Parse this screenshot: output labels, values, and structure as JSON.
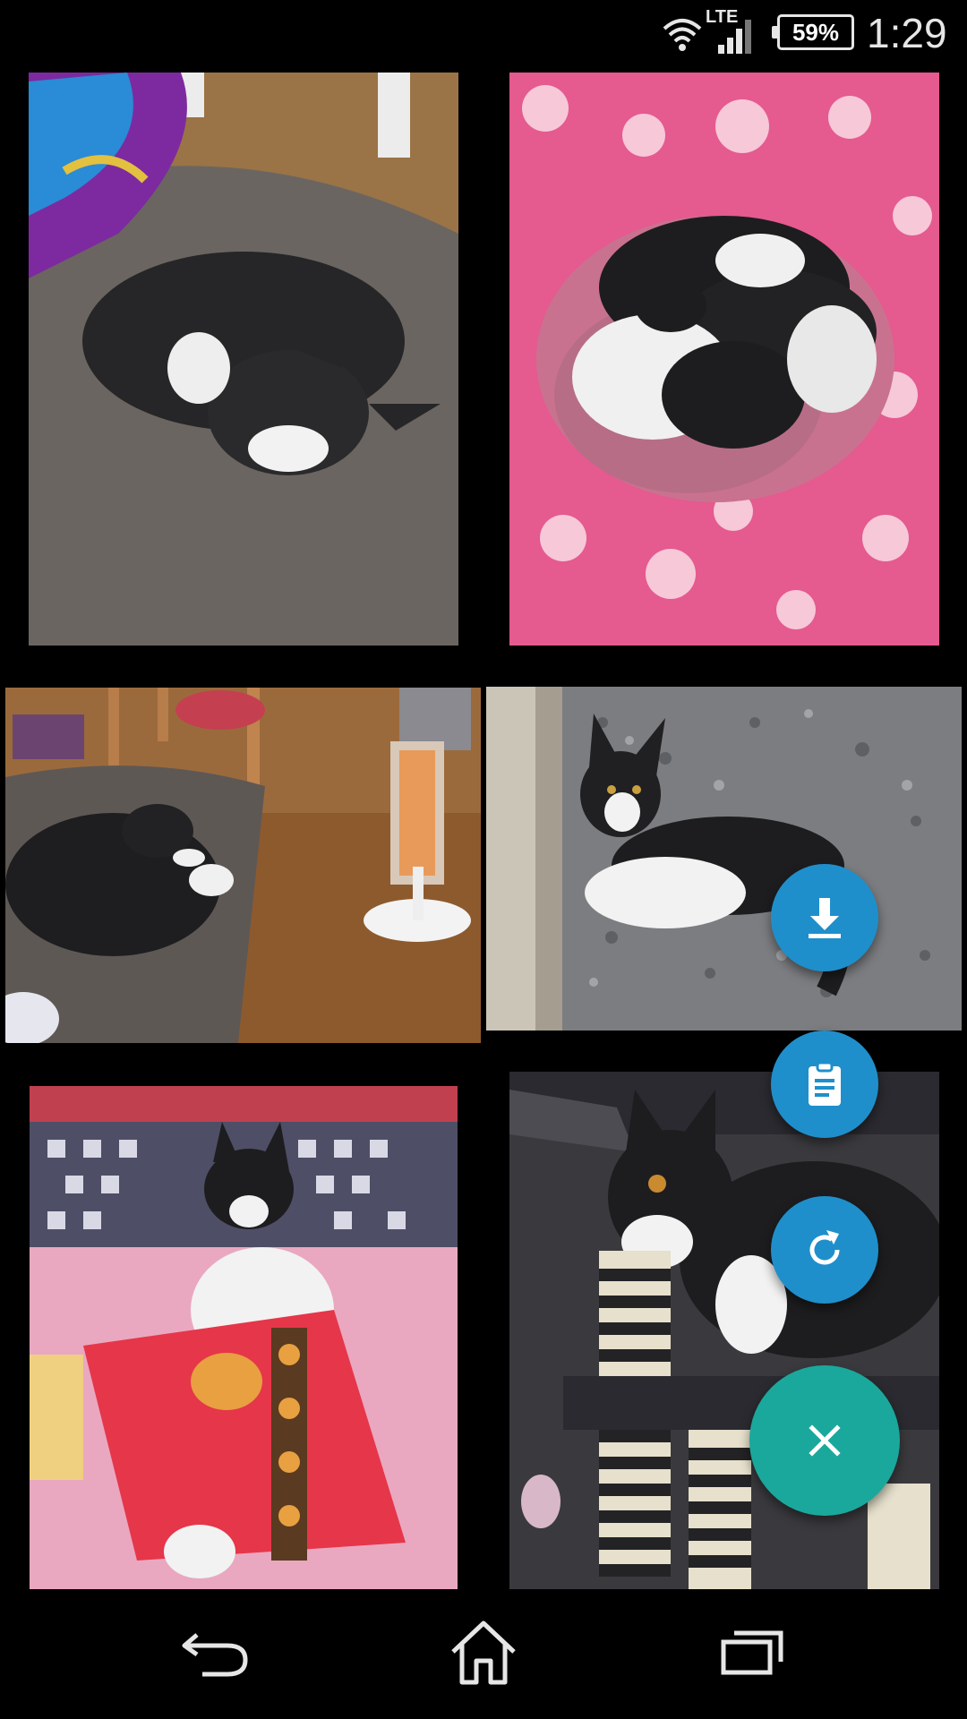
{
  "status_bar": {
    "network_label": "LTE",
    "battery": "59%",
    "time": "1:29",
    "icons": [
      "wifi-icon",
      "signal-icon",
      "battery-icon"
    ]
  },
  "gallery": {
    "photos": [
      {
        "name": "cat-sleeping-on-cushion"
      },
      {
        "name": "kittens-in-pink-basket"
      },
      {
        "name": "cat-on-cushion-near-heater"
      },
      {
        "name": "kitten-on-gravel"
      },
      {
        "name": "cat-under-red-towel"
      },
      {
        "name": "cat-on-scratching-post"
      }
    ]
  },
  "actions": {
    "download_icon": "download-icon",
    "clipboard_icon": "clipboard-icon",
    "refresh_icon": "refresh-icon",
    "close_icon": "close-icon",
    "colors": {
      "blue": "#1f8fcb",
      "teal": "#1aa89c"
    }
  },
  "nav_bar": {
    "icons": [
      "back-icon",
      "home-icon",
      "recents-icon"
    ]
  }
}
